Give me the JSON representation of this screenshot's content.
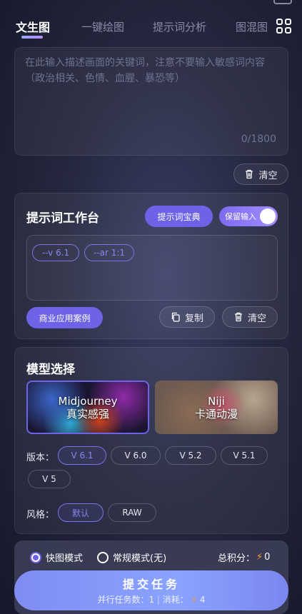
{
  "tabs": {
    "items": [
      "文生图",
      "一键绘图",
      "提示词分析",
      "图混图"
    ],
    "active": "文生图"
  },
  "prompt": {
    "placeholder": "在此输入描述画面的关键词，注意不要输入敏感词内容（政治相关、色情、血腥、暴恐等）",
    "counter": "0/1800",
    "clear_label": "清空"
  },
  "workbench": {
    "title": "提示词工作台",
    "dictionary_label": "提示词宝典",
    "keep_input_label": "保留输入",
    "keep_input_on": true,
    "tags": [
      "--v 6.1",
      "--ar 1:1"
    ],
    "case_label": "商业应用案例",
    "copy_label": "复制",
    "clear_label": "清空"
  },
  "model": {
    "title": "模型选择",
    "options": [
      {
        "name": "Midjourney",
        "sub": "真实感强",
        "selected": true
      },
      {
        "name": "Niji",
        "sub": "卡通动漫",
        "selected": false
      }
    ],
    "version_label": "版本：",
    "versions": [
      "V 6.1",
      "V 6.0",
      "V 5.2",
      "V 5.1",
      "V 5"
    ],
    "version_selected": "V 6.1",
    "style_label": "风格：",
    "styles": [
      "默认",
      "RAW"
    ],
    "style_selected": "默认"
  },
  "bottom": {
    "mode_fast": "快图模式",
    "mode_normal": "常规模式(无)",
    "total_label": "总积分：",
    "total_value": "0",
    "submit_label": "提交任务",
    "parallel_label": "并行任务数：1",
    "cost_label": "消耗：",
    "cost_value": "4"
  },
  "colors": {
    "accent": "#6e63e6",
    "bolt": "#ff9a2e"
  }
}
